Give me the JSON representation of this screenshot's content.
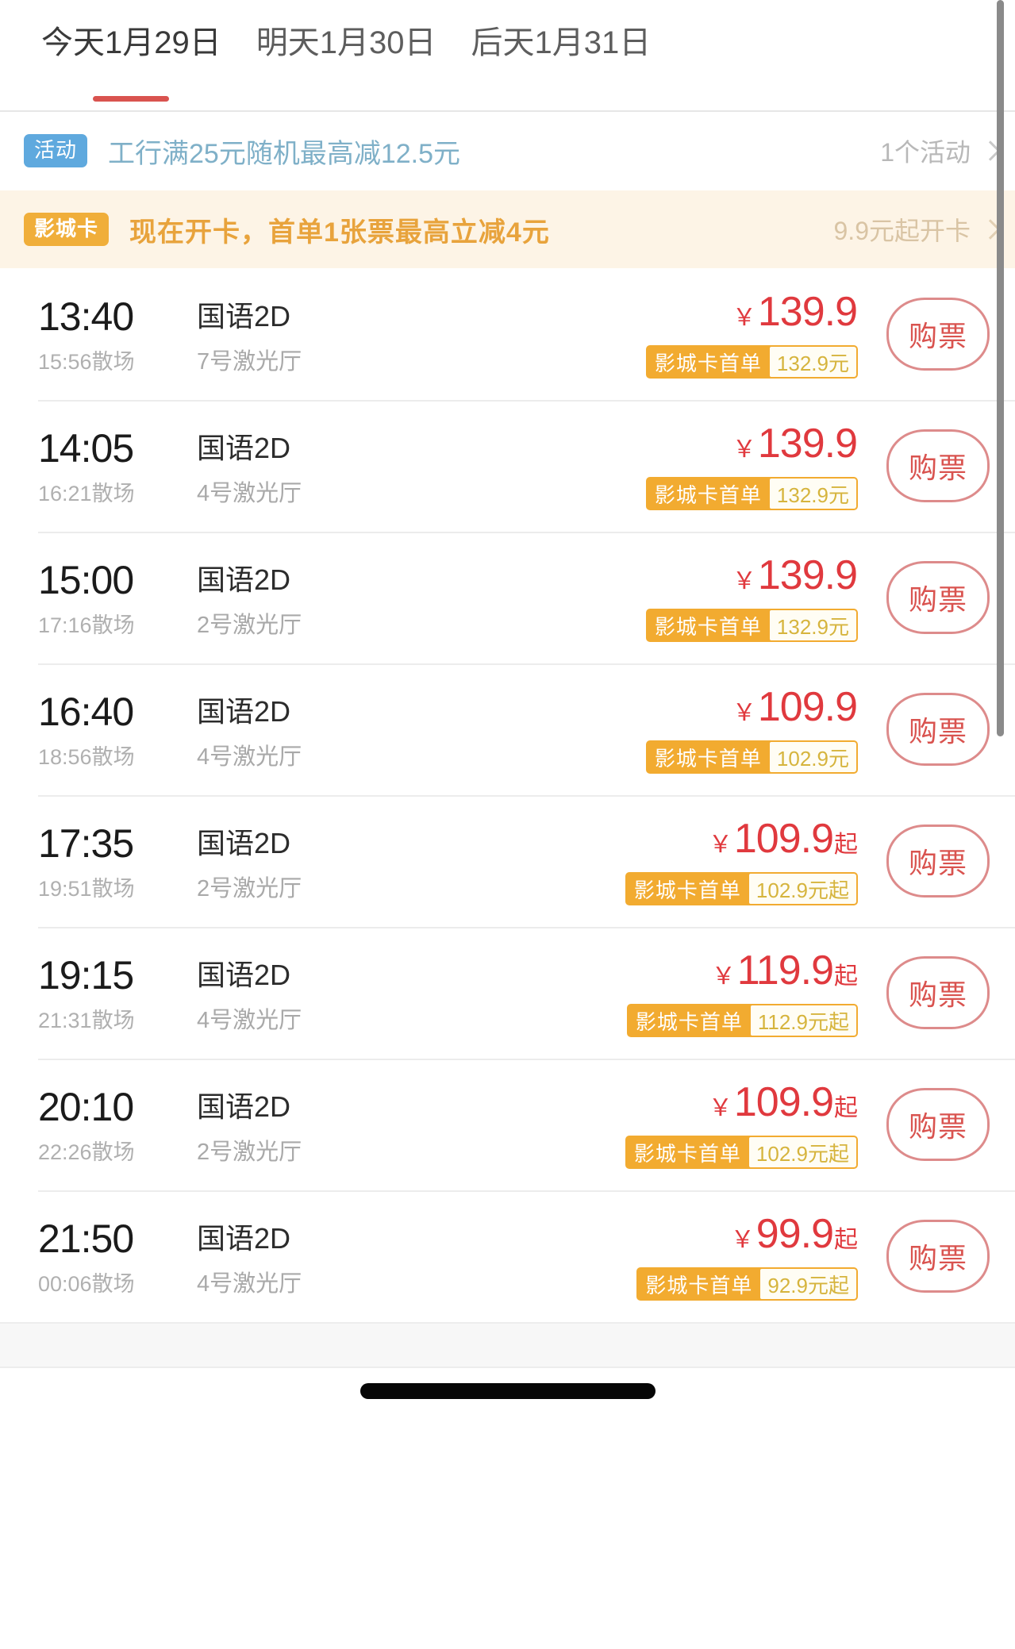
{
  "date_tabs": [
    {
      "label": "今天1月29日",
      "active": true
    },
    {
      "label": "明天1月30日",
      "active": false
    },
    {
      "label": "后天1月31日",
      "active": false
    }
  ],
  "activity_banner": {
    "badge": "活动",
    "text": "工行满25元随机最高减12.5元",
    "right_label": "1个活动",
    "chevron_icon": "chevron-right-icon",
    "badge_color": "#5fa9de",
    "text_color": "#7fb0c8"
  },
  "card_banner": {
    "badge": "影城卡",
    "text": "现在开卡，首单1张票最高立减4元",
    "right_label": "9.9元起开卡",
    "chevron_icon": "chevron-right-icon",
    "badge_color": "#f0ae3a",
    "text_color": "#e8a33c",
    "background": "#fdf4e6"
  },
  "showtimes": [
    {
      "start_time": "13:40",
      "end_time": "15:56散场",
      "language_format": "国语2D",
      "hall": "7号激光厅",
      "currency": "￥",
      "price": "139.9",
      "price_suffix": "",
      "card_tag_label": "影城卡首单",
      "card_tag_price": "132.9元",
      "buy_label": "购票"
    },
    {
      "start_time": "14:05",
      "end_time": "16:21散场",
      "language_format": "国语2D",
      "hall": "4号激光厅",
      "currency": "￥",
      "price": "139.9",
      "price_suffix": "",
      "card_tag_label": "影城卡首单",
      "card_tag_price": "132.9元",
      "buy_label": "购票"
    },
    {
      "start_time": "15:00",
      "end_time": "17:16散场",
      "language_format": "国语2D",
      "hall": "2号激光厅",
      "currency": "￥",
      "price": "139.9",
      "price_suffix": "",
      "card_tag_label": "影城卡首单",
      "card_tag_price": "132.9元",
      "buy_label": "购票"
    },
    {
      "start_time": "16:40",
      "end_time": "18:56散场",
      "language_format": "国语2D",
      "hall": "4号激光厅",
      "currency": "￥",
      "price": "109.9",
      "price_suffix": "",
      "card_tag_label": "影城卡首单",
      "card_tag_price": "102.9元",
      "buy_label": "购票"
    },
    {
      "start_time": "17:35",
      "end_time": "19:51散场",
      "language_format": "国语2D",
      "hall": "2号激光厅",
      "currency": "￥",
      "price": "109.9",
      "price_suffix": "起",
      "card_tag_label": "影城卡首单",
      "card_tag_price": "102.9元起",
      "buy_label": "购票"
    },
    {
      "start_time": "19:15",
      "end_time": "21:31散场",
      "language_format": "国语2D",
      "hall": "4号激光厅",
      "currency": "￥",
      "price": "119.9",
      "price_suffix": "起",
      "card_tag_label": "影城卡首单",
      "card_tag_price": "112.9元起",
      "buy_label": "购票"
    },
    {
      "start_time": "20:10",
      "end_time": "22:26散场",
      "language_format": "国语2D",
      "hall": "2号激光厅",
      "currency": "￥",
      "price": "109.9",
      "price_suffix": "起",
      "card_tag_label": "影城卡首单",
      "card_tag_price": "102.9元起",
      "buy_label": "购票"
    },
    {
      "start_time": "21:50",
      "end_time": "00:06散场",
      "language_format": "国语2D",
      "hall": "4号激光厅",
      "currency": "￥",
      "price": "99.9",
      "price_suffix": "起",
      "card_tag_label": "影城卡首单",
      "card_tag_price": "92.9元起",
      "buy_label": "购票"
    }
  ],
  "colors": {
    "accent_red": "#e0393e",
    "tab_underline": "#d9534f",
    "card_orange": "#f2ab30",
    "activity_blue": "#5fa9de"
  }
}
